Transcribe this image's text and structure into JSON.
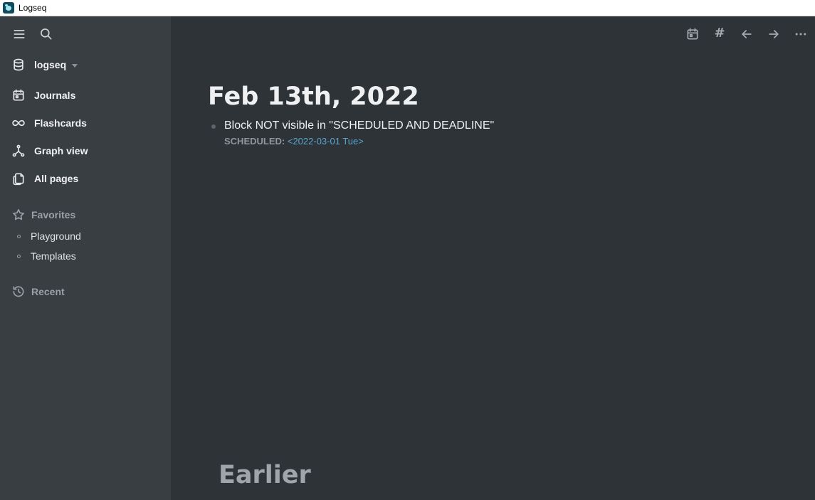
{
  "window": {
    "title": "Logseq"
  },
  "sidebar": {
    "graph": {
      "name": "logseq",
      "icon": "database-icon"
    },
    "nav": [
      {
        "label": "Journals",
        "icon": "calendar-icon"
      },
      {
        "label": "Flashcards",
        "icon": "infinity-icon"
      },
      {
        "label": "Graph view",
        "icon": "graph-icon"
      },
      {
        "label": "All pages",
        "icon": "pages-icon"
      }
    ],
    "favorites": {
      "label": "Favorites",
      "items": [
        "Playground",
        "Templates"
      ]
    },
    "recent": {
      "label": "Recent"
    }
  },
  "header": {
    "icons": [
      "menu-icon",
      "search-icon",
      "calendar-icon",
      "hash-icon",
      "arrow-left-icon",
      "arrow-right-icon",
      "more-icon"
    ],
    "hash_glyph": "#"
  },
  "journal": {
    "title": "Feb 13th, 2022",
    "blocks": [
      {
        "text": "Block NOT visible in \"SCHEDULED AND DEADLINE\"",
        "scheduled_label": "SCHEDULED:",
        "scheduled_date": "<2022-03-01 Tue>"
      }
    ]
  },
  "footer": {
    "earlier_label": "Earlier"
  },
  "colors": {
    "sidebar_bg": "#393e43",
    "main_bg": "#2e3338",
    "link": "#5aa5cf"
  }
}
